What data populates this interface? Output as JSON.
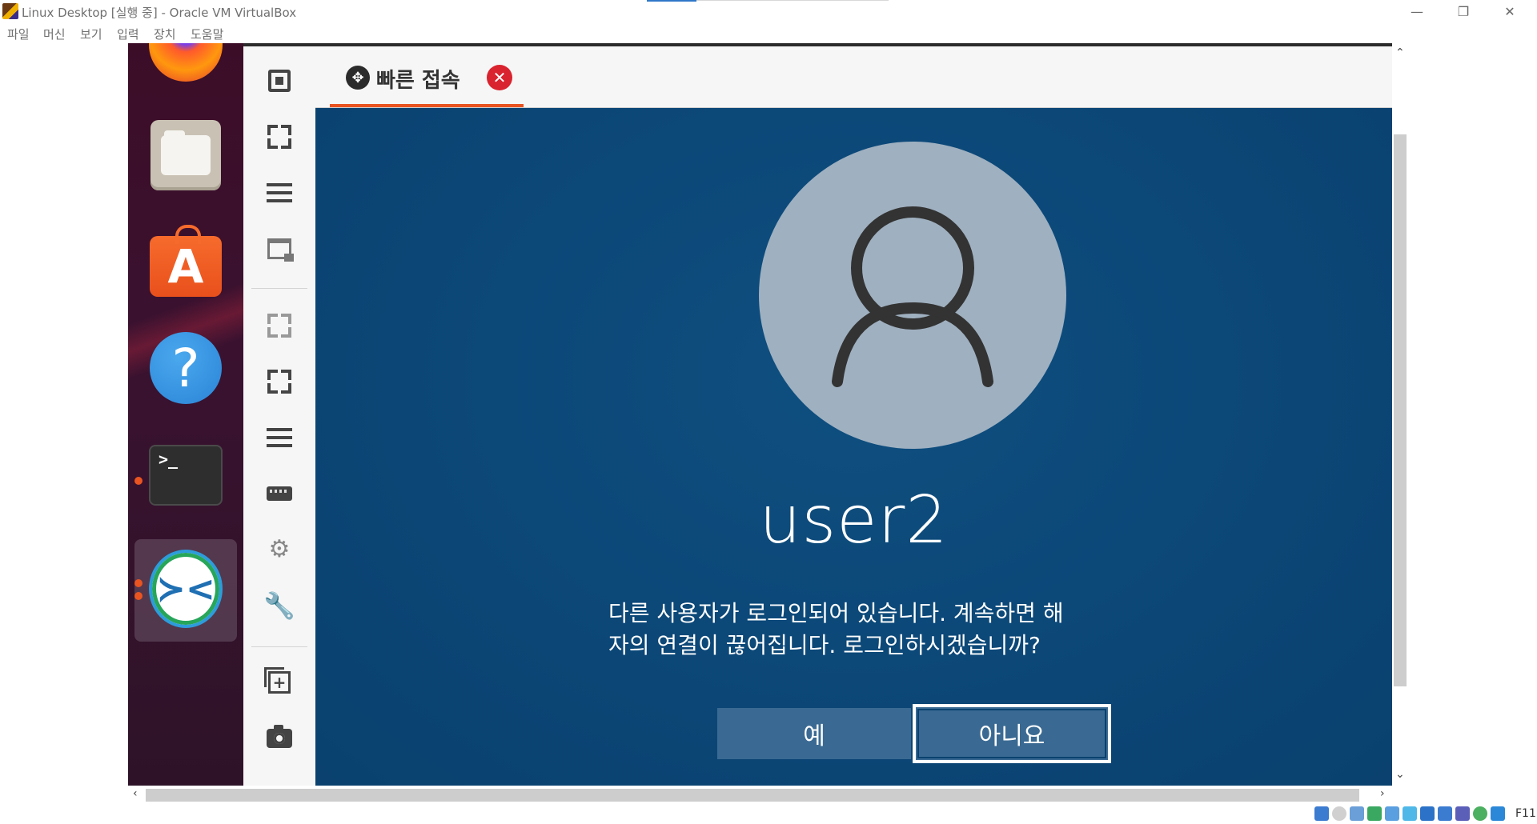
{
  "window": {
    "title": "Linux Desktop [실행 중] - Oracle VM VirtualBox",
    "controls": {
      "minimize": "—",
      "restore": "❐",
      "close": "✕"
    }
  },
  "menubar": [
    "파일",
    "머신",
    "보기",
    "입력",
    "장치",
    "도움말"
  ],
  "dock": {
    "apps": [
      "firefox-icon",
      "files-icon",
      "software-center-icon",
      "help-icon",
      "terminal-icon",
      "remmina-icon"
    ],
    "store_glyph": "A",
    "help_glyph": "?",
    "terminal_glyph": ">_",
    "remmina_glyph": "≻<",
    "accent_color": "#e95420"
  },
  "toolbar": {
    "icons": [
      "fit-window-icon",
      "fullscreen-icon",
      "menu-icon",
      "scaled-view-icon",
      "dynamic-resolution-icon",
      "fullscreen-toggle-icon",
      "more-menu-icon",
      "keyboard-icon",
      "preferences-icon",
      "tools-icon",
      "new-window-icon",
      "screenshot-icon"
    ],
    "gear_glyph": "⚙",
    "wrench_glyph": "🔧",
    "add_glyph": "+"
  },
  "tab": {
    "label": "빠른 접속",
    "icon_glyph": "✥",
    "close_glyph": "✕",
    "accent_color": "#e95420"
  },
  "remote": {
    "background_color": "#0b4676",
    "username": "user2",
    "message_line1": "다른 사용자가 로그인되어 있습니다. 계속하면 해",
    "message_line2": "자의 연결이 끊어집니다. 로그인하시겠습니까?",
    "yes_label": "예",
    "no_label": "아니요"
  },
  "scrollbars": {
    "up": "⌃",
    "down": "⌄",
    "left": "‹",
    "right": "›"
  },
  "statusbar": {
    "host_key": "F11"
  }
}
